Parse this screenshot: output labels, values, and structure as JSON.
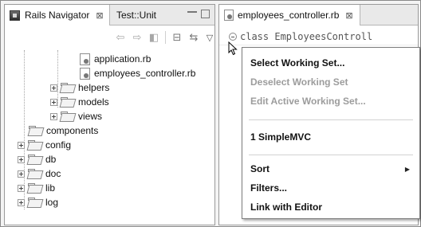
{
  "left_view": {
    "tabs": [
      {
        "label": "Rails Navigator",
        "close_glyph": "⊠",
        "icon": "rails-navigator-icon"
      },
      {
        "label": "Test::Unit"
      }
    ],
    "toolbar": {
      "back_glyph": "⇦",
      "forward_glyph": "⇨",
      "up_glyph": "◧",
      "collapse_glyph": "⊟",
      "link_glyph": "⇆",
      "menu_glyph": "▽"
    },
    "tree": [
      {
        "label": "application.rb",
        "kind": "file"
      },
      {
        "label": "employees_controller.rb",
        "kind": "file"
      },
      {
        "label": "helpers",
        "kind": "folder"
      },
      {
        "label": "models",
        "kind": "folder"
      },
      {
        "label": "views",
        "kind": "folder"
      },
      {
        "label": "components",
        "kind": "folder"
      },
      {
        "label": "config",
        "kind": "folder"
      },
      {
        "label": "db",
        "kind": "folder"
      },
      {
        "label": "doc",
        "kind": "folder"
      },
      {
        "label": "lib",
        "kind": "folder"
      },
      {
        "label": "log",
        "kind": "folder"
      }
    ]
  },
  "editor": {
    "tab_label": "employees_controller.rb",
    "tab_close_glyph": "⊠",
    "code_line": "class EmployeesControll"
  },
  "view_menu": {
    "items": [
      {
        "label": "Select Working Set...",
        "enabled": true
      },
      {
        "label": "Deselect Working Set",
        "enabled": false
      },
      {
        "label": "Edit Active Working Set...",
        "enabled": false
      },
      {
        "label": "1 SimpleMVC",
        "enabled": true
      },
      {
        "label": "Sort",
        "enabled": true,
        "submenu_glyph": "▶"
      },
      {
        "label": "Filters...",
        "enabled": true
      },
      {
        "label": "Link with Editor",
        "enabled": true
      }
    ]
  }
}
